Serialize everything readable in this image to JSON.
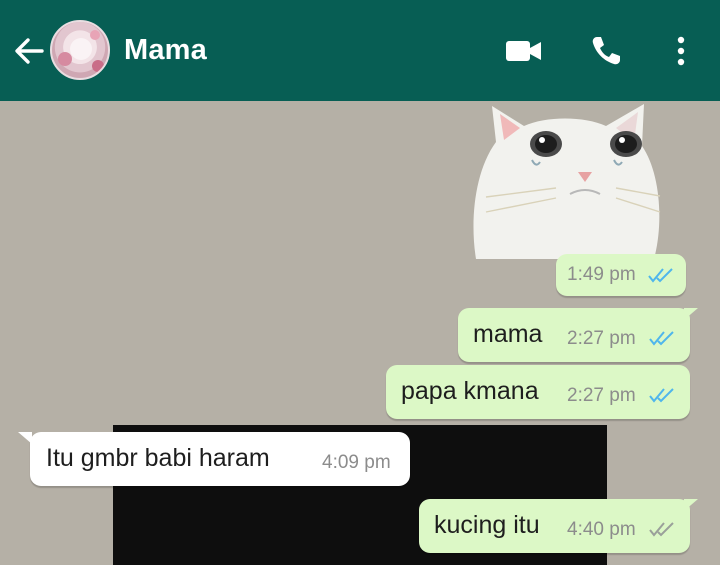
{
  "header": {
    "contact_name": "Mama",
    "back_icon": "arrow-left-icon",
    "video_icon": "video-camera-icon",
    "call_icon": "phone-icon",
    "menu_icon": "more-vertical-icon"
  },
  "colors": {
    "header_bg": "#075e54",
    "chat_bg": "#b5b0a6",
    "outgoing_bubble": "#dcf8c6",
    "incoming_bubble": "#ffffff",
    "read_tick": "#4fb6ec",
    "delivered_tick": "#9aa09a"
  },
  "messages": [
    {
      "direction": "out",
      "kind": "sticker",
      "sticker": "crying-cat-sticker",
      "time": "1:49 pm",
      "status": "read"
    },
    {
      "direction": "out",
      "kind": "text",
      "text": "mama",
      "time": "2:27 pm",
      "status": "read"
    },
    {
      "direction": "out",
      "kind": "text",
      "text": "papa kmana",
      "time": "2:27 pm",
      "status": "read"
    },
    {
      "direction": "in",
      "kind": "text",
      "text": "Itu gmbr babi haram",
      "time": "4:09 pm"
    },
    {
      "direction": "out",
      "kind": "text",
      "text": "kucing itu",
      "time": "4:40 pm",
      "status": "delivered"
    }
  ]
}
